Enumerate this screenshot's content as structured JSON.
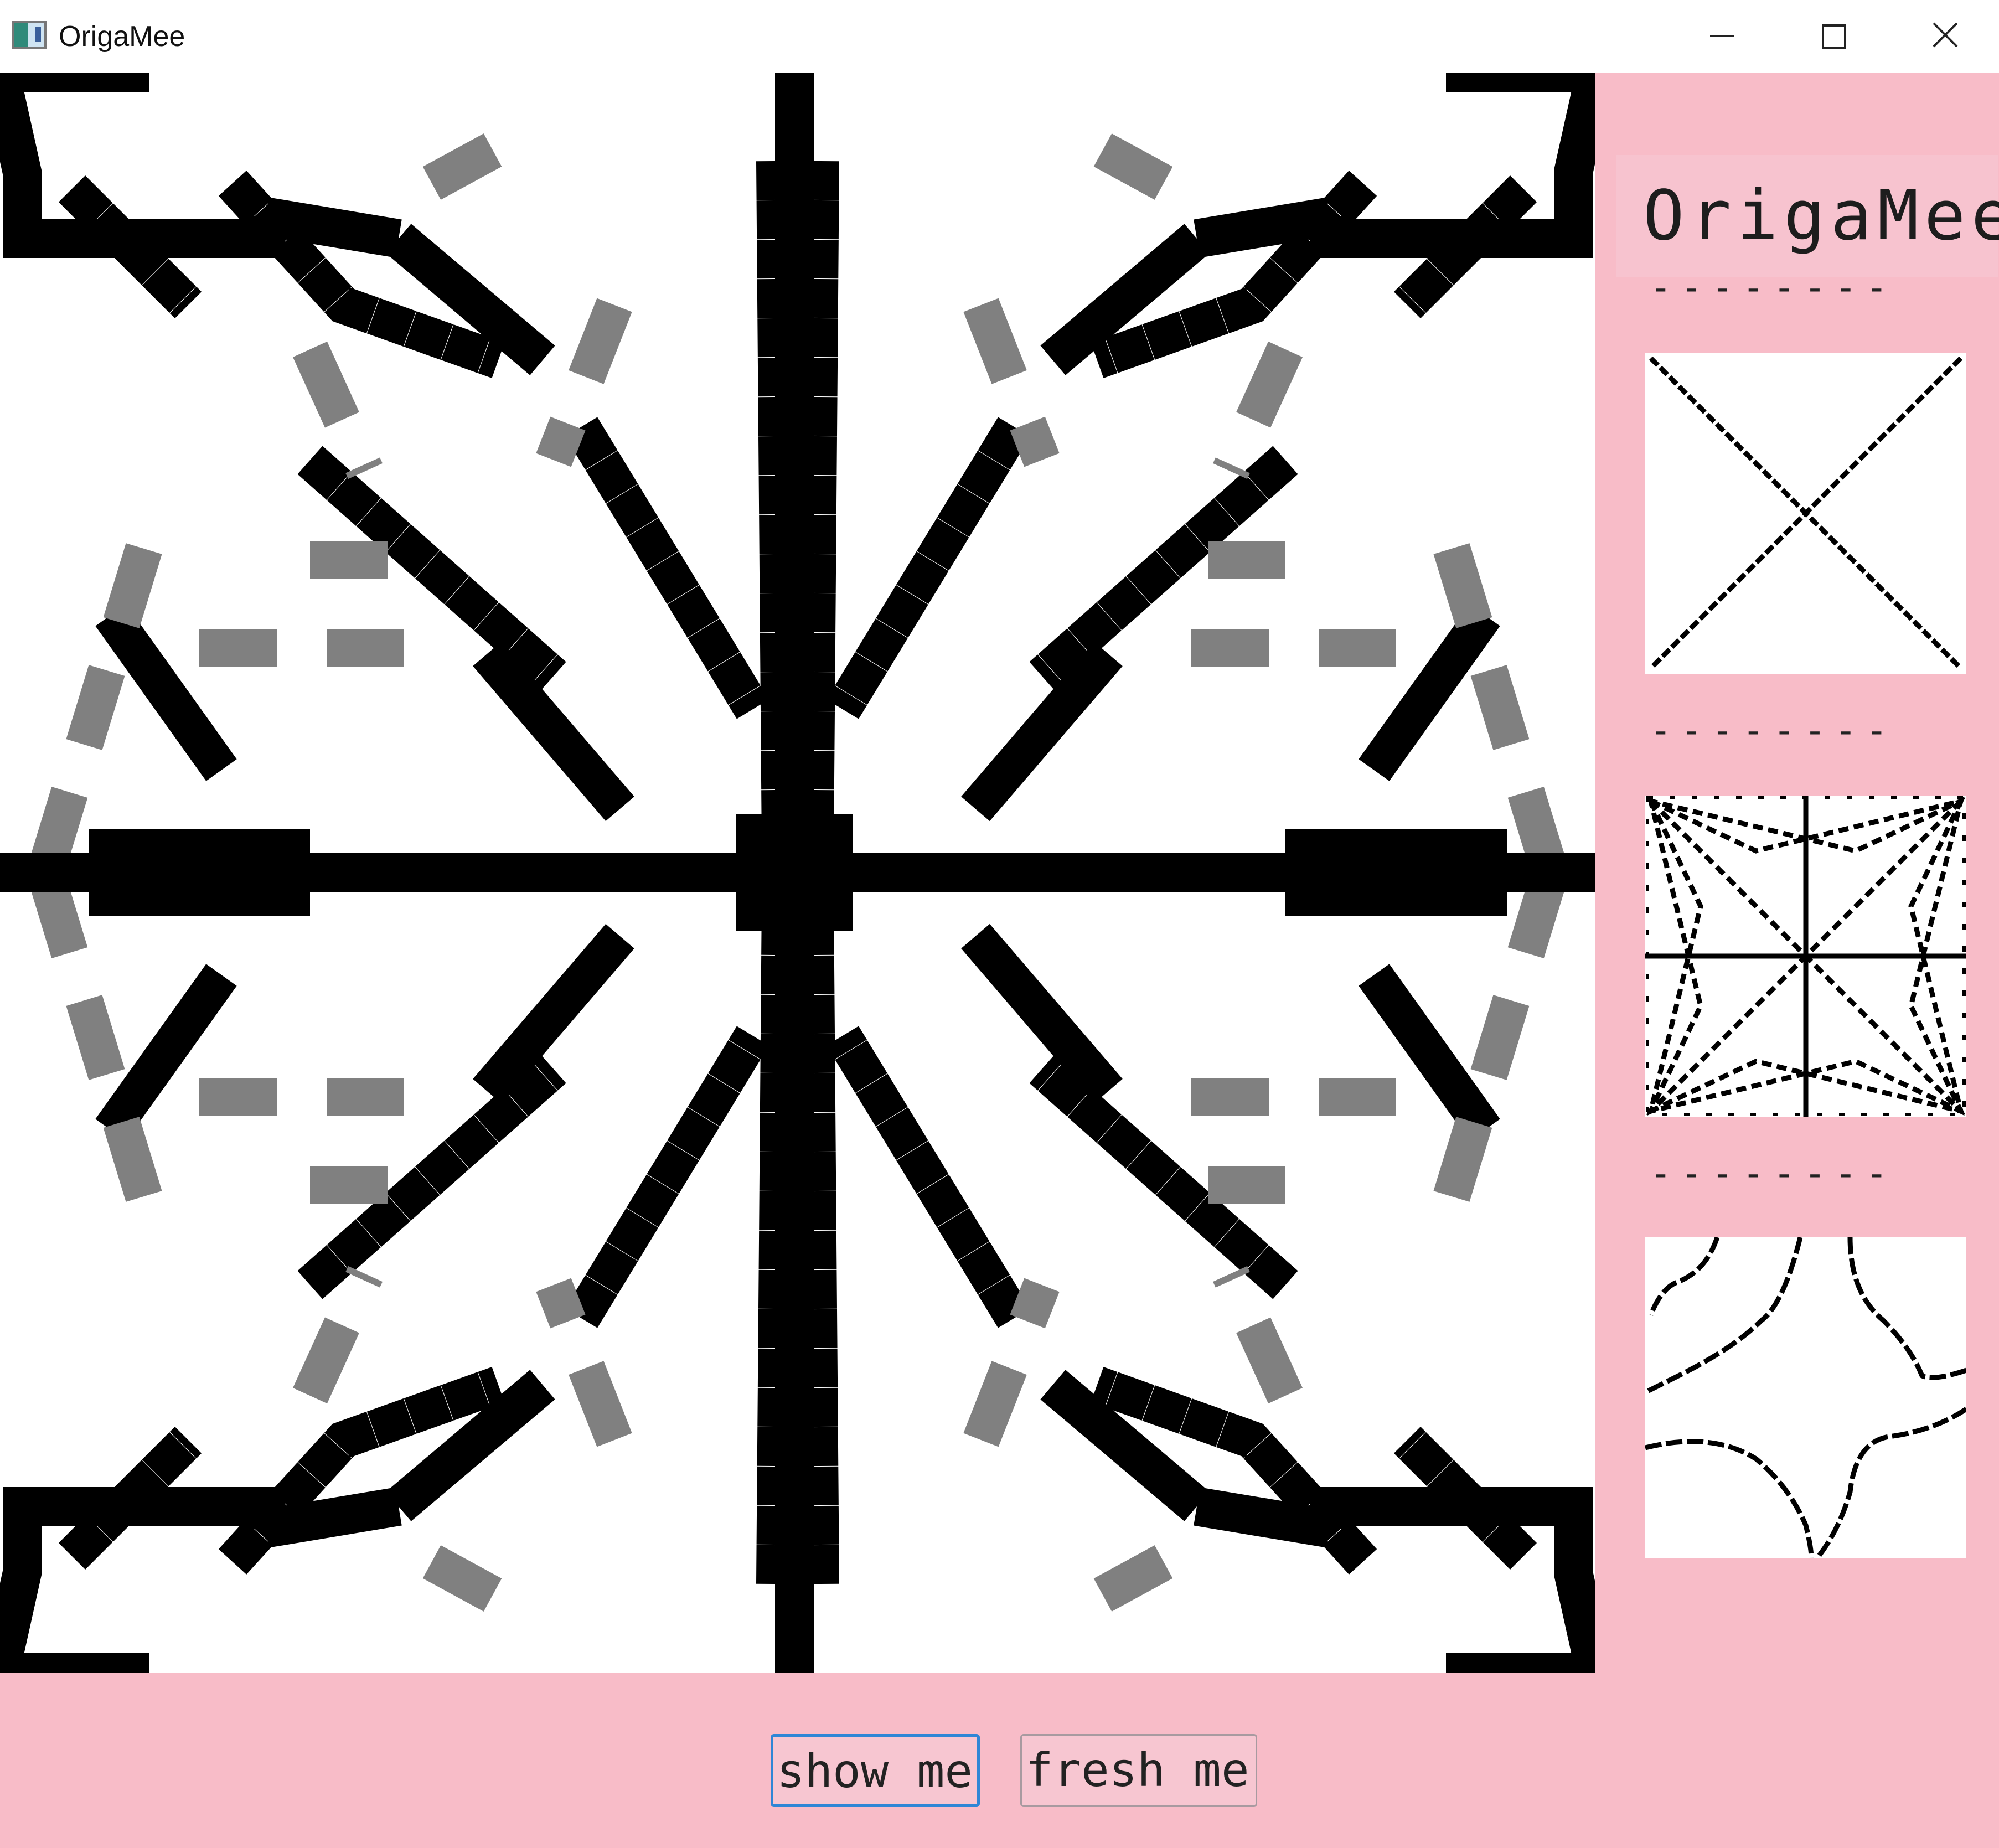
{
  "window": {
    "title": "OrigaMee"
  },
  "sidebar": {
    "title": "OrigaMee",
    "separator": "--------"
  },
  "buttons": {
    "show_label": "show me",
    "fresh_label": "fresh me"
  },
  "colors": {
    "background": "#f8bcc8",
    "ink": "#000000",
    "fold_gray": "#808080"
  },
  "icons": [
    "app-icon",
    "minimize-icon",
    "maximize-icon",
    "close-icon"
  ]
}
